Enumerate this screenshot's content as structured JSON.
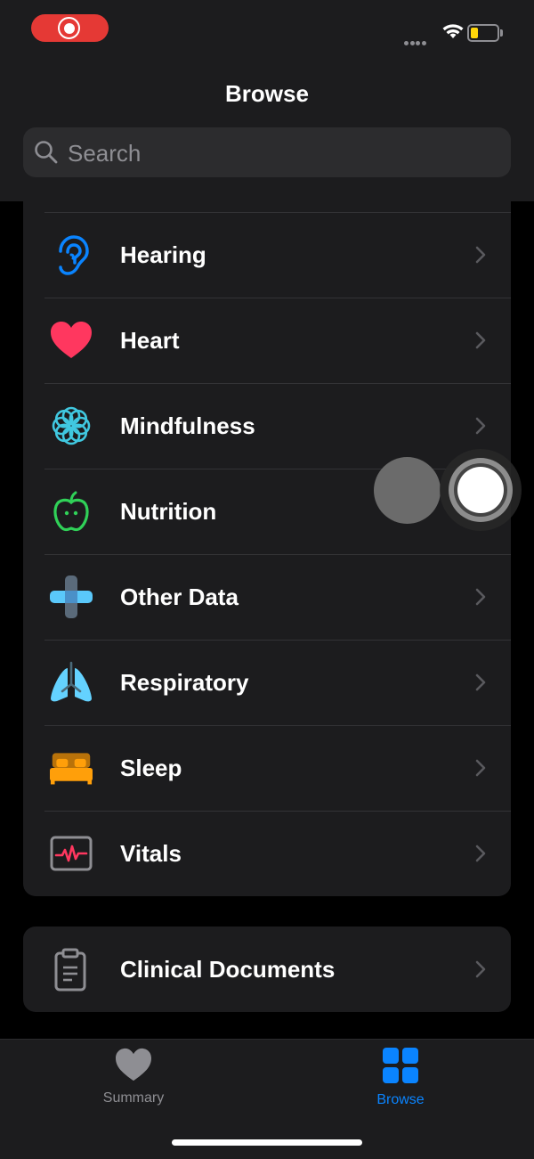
{
  "header": {
    "title": "Browse",
    "search_placeholder": "Search"
  },
  "categories": [
    {
      "label": "Hearing",
      "icon": "ear-icon",
      "color": "#0a84ff"
    },
    {
      "label": "Heart",
      "icon": "heart-icon",
      "color": "#ff375f"
    },
    {
      "label": "Mindfulness",
      "icon": "mindfulness-flower-icon",
      "color": "#40c8e0"
    },
    {
      "label": "Nutrition",
      "icon": "apple-icon",
      "color": "#30d158"
    },
    {
      "label": "Other Data",
      "icon": "plus-cross-icon",
      "color": "#5ac8fa"
    },
    {
      "label": "Respiratory",
      "icon": "lungs-icon",
      "color": "#64d2ff"
    },
    {
      "label": "Sleep",
      "icon": "bed-icon",
      "color": "#ff9f0a"
    },
    {
      "label": "Vitals",
      "icon": "vitals-monitor-icon",
      "color": "#ff375f"
    }
  ],
  "clinical": {
    "label": "Clinical Documents",
    "icon": "clipboard-icon"
  },
  "tabbar": {
    "summary_label": "Summary",
    "browse_label": "Browse",
    "active": "Browse",
    "accent": "#0a84ff"
  }
}
